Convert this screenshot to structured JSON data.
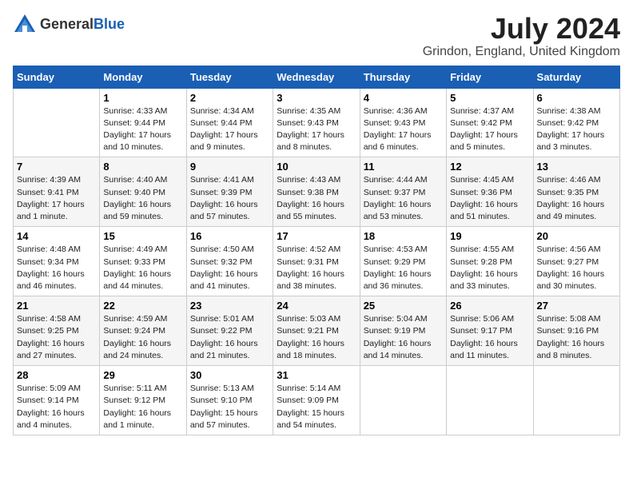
{
  "header": {
    "logo_general": "General",
    "logo_blue": "Blue",
    "month_title": "July 2024",
    "location": "Grindon, England, United Kingdom"
  },
  "weekdays": [
    "Sunday",
    "Monday",
    "Tuesday",
    "Wednesday",
    "Thursday",
    "Friday",
    "Saturday"
  ],
  "weeks": [
    [
      {
        "day": null
      },
      {
        "day": "1",
        "sunrise": "Sunrise: 4:33 AM",
        "sunset": "Sunset: 9:44 PM",
        "daylight": "Daylight: 17 hours and 10 minutes."
      },
      {
        "day": "2",
        "sunrise": "Sunrise: 4:34 AM",
        "sunset": "Sunset: 9:44 PM",
        "daylight": "Daylight: 17 hours and 9 minutes."
      },
      {
        "day": "3",
        "sunrise": "Sunrise: 4:35 AM",
        "sunset": "Sunset: 9:43 PM",
        "daylight": "Daylight: 17 hours and 8 minutes."
      },
      {
        "day": "4",
        "sunrise": "Sunrise: 4:36 AM",
        "sunset": "Sunset: 9:43 PM",
        "daylight": "Daylight: 17 hours and 6 minutes."
      },
      {
        "day": "5",
        "sunrise": "Sunrise: 4:37 AM",
        "sunset": "Sunset: 9:42 PM",
        "daylight": "Daylight: 17 hours and 5 minutes."
      },
      {
        "day": "6",
        "sunrise": "Sunrise: 4:38 AM",
        "sunset": "Sunset: 9:42 PM",
        "daylight": "Daylight: 17 hours and 3 minutes."
      }
    ],
    [
      {
        "day": "7",
        "sunrise": "Sunrise: 4:39 AM",
        "sunset": "Sunset: 9:41 PM",
        "daylight": "Daylight: 17 hours and 1 minute."
      },
      {
        "day": "8",
        "sunrise": "Sunrise: 4:40 AM",
        "sunset": "Sunset: 9:40 PM",
        "daylight": "Daylight: 16 hours and 59 minutes."
      },
      {
        "day": "9",
        "sunrise": "Sunrise: 4:41 AM",
        "sunset": "Sunset: 9:39 PM",
        "daylight": "Daylight: 16 hours and 57 minutes."
      },
      {
        "day": "10",
        "sunrise": "Sunrise: 4:43 AM",
        "sunset": "Sunset: 9:38 PM",
        "daylight": "Daylight: 16 hours and 55 minutes."
      },
      {
        "day": "11",
        "sunrise": "Sunrise: 4:44 AM",
        "sunset": "Sunset: 9:37 PM",
        "daylight": "Daylight: 16 hours and 53 minutes."
      },
      {
        "day": "12",
        "sunrise": "Sunrise: 4:45 AM",
        "sunset": "Sunset: 9:36 PM",
        "daylight": "Daylight: 16 hours and 51 minutes."
      },
      {
        "day": "13",
        "sunrise": "Sunrise: 4:46 AM",
        "sunset": "Sunset: 9:35 PM",
        "daylight": "Daylight: 16 hours and 49 minutes."
      }
    ],
    [
      {
        "day": "14",
        "sunrise": "Sunrise: 4:48 AM",
        "sunset": "Sunset: 9:34 PM",
        "daylight": "Daylight: 16 hours and 46 minutes."
      },
      {
        "day": "15",
        "sunrise": "Sunrise: 4:49 AM",
        "sunset": "Sunset: 9:33 PM",
        "daylight": "Daylight: 16 hours and 44 minutes."
      },
      {
        "day": "16",
        "sunrise": "Sunrise: 4:50 AM",
        "sunset": "Sunset: 9:32 PM",
        "daylight": "Daylight: 16 hours and 41 minutes."
      },
      {
        "day": "17",
        "sunrise": "Sunrise: 4:52 AM",
        "sunset": "Sunset: 9:31 PM",
        "daylight": "Daylight: 16 hours and 38 minutes."
      },
      {
        "day": "18",
        "sunrise": "Sunrise: 4:53 AM",
        "sunset": "Sunset: 9:29 PM",
        "daylight": "Daylight: 16 hours and 36 minutes."
      },
      {
        "day": "19",
        "sunrise": "Sunrise: 4:55 AM",
        "sunset": "Sunset: 9:28 PM",
        "daylight": "Daylight: 16 hours and 33 minutes."
      },
      {
        "day": "20",
        "sunrise": "Sunrise: 4:56 AM",
        "sunset": "Sunset: 9:27 PM",
        "daylight": "Daylight: 16 hours and 30 minutes."
      }
    ],
    [
      {
        "day": "21",
        "sunrise": "Sunrise: 4:58 AM",
        "sunset": "Sunset: 9:25 PM",
        "daylight": "Daylight: 16 hours and 27 minutes."
      },
      {
        "day": "22",
        "sunrise": "Sunrise: 4:59 AM",
        "sunset": "Sunset: 9:24 PM",
        "daylight": "Daylight: 16 hours and 24 minutes."
      },
      {
        "day": "23",
        "sunrise": "Sunrise: 5:01 AM",
        "sunset": "Sunset: 9:22 PM",
        "daylight": "Daylight: 16 hours and 21 minutes."
      },
      {
        "day": "24",
        "sunrise": "Sunrise: 5:03 AM",
        "sunset": "Sunset: 9:21 PM",
        "daylight": "Daylight: 16 hours and 18 minutes."
      },
      {
        "day": "25",
        "sunrise": "Sunrise: 5:04 AM",
        "sunset": "Sunset: 9:19 PM",
        "daylight": "Daylight: 16 hours and 14 minutes."
      },
      {
        "day": "26",
        "sunrise": "Sunrise: 5:06 AM",
        "sunset": "Sunset: 9:17 PM",
        "daylight": "Daylight: 16 hours and 11 minutes."
      },
      {
        "day": "27",
        "sunrise": "Sunrise: 5:08 AM",
        "sunset": "Sunset: 9:16 PM",
        "daylight": "Daylight: 16 hours and 8 minutes."
      }
    ],
    [
      {
        "day": "28",
        "sunrise": "Sunrise: 5:09 AM",
        "sunset": "Sunset: 9:14 PM",
        "daylight": "Daylight: 16 hours and 4 minutes."
      },
      {
        "day": "29",
        "sunrise": "Sunrise: 5:11 AM",
        "sunset": "Sunset: 9:12 PM",
        "daylight": "Daylight: 16 hours and 1 minute."
      },
      {
        "day": "30",
        "sunrise": "Sunrise: 5:13 AM",
        "sunset": "Sunset: 9:10 PM",
        "daylight": "Daylight: 15 hours and 57 minutes."
      },
      {
        "day": "31",
        "sunrise": "Sunrise: 5:14 AM",
        "sunset": "Sunset: 9:09 PM",
        "daylight": "Daylight: 15 hours and 54 minutes."
      },
      {
        "day": null
      },
      {
        "day": null
      },
      {
        "day": null
      }
    ]
  ]
}
